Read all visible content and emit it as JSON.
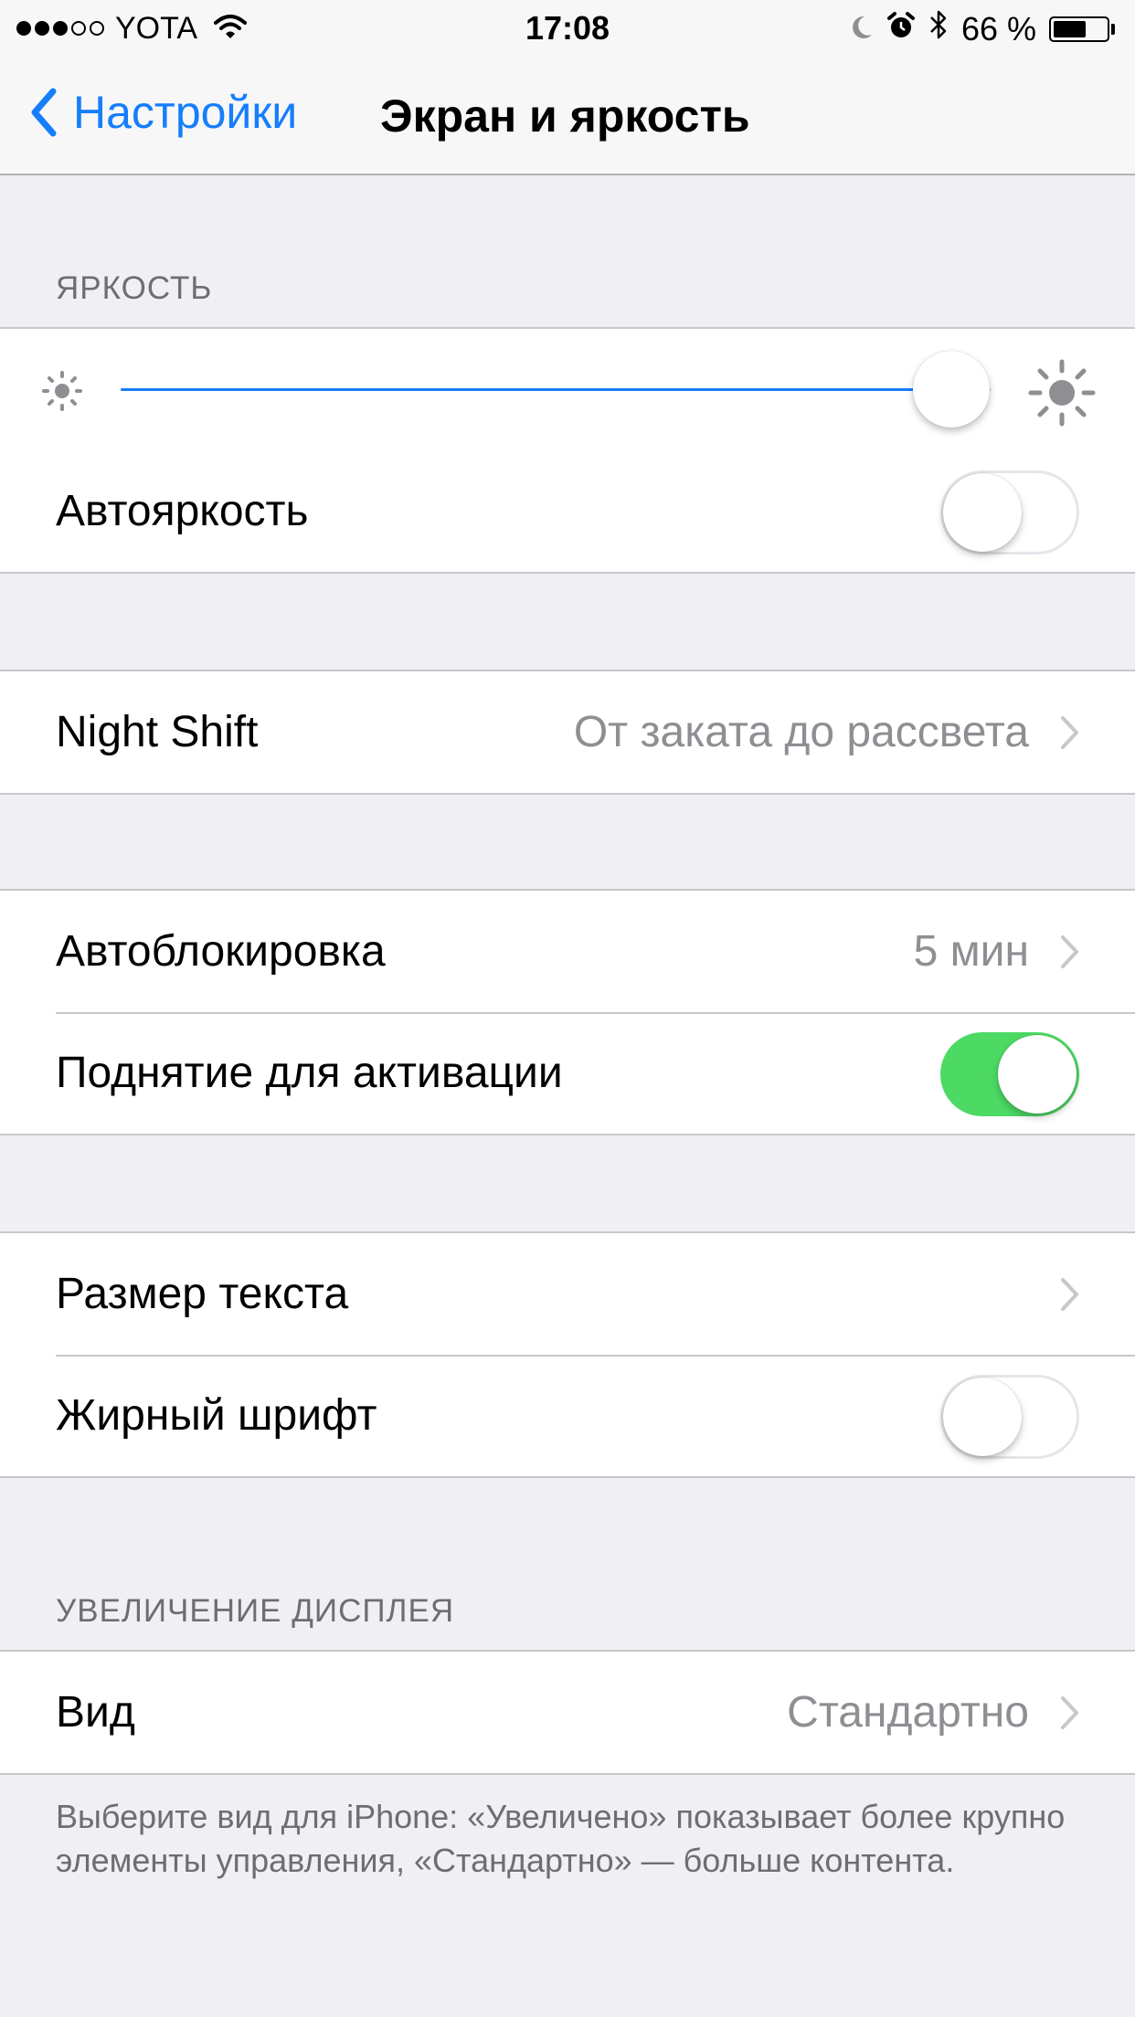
{
  "status_bar": {
    "signal_dots_filled": 3,
    "signal_dots_total": 5,
    "carrier": "YOTA",
    "time": "17:08",
    "battery_percent_label": "66 %",
    "battery_level": 0.66,
    "icons": [
      "wifi-icon",
      "moon-icon",
      "alarm-icon",
      "bluetooth-icon",
      "battery-icon"
    ]
  },
  "nav": {
    "back_label": "Настройки",
    "title": "Экран и яркость"
  },
  "sections": {
    "brightness": {
      "header": "ЯРКОСТЬ",
      "slider_level": 0.955,
      "auto_label": "Автояркость",
      "auto_on": false
    },
    "night_shift": {
      "label": "Night Shift",
      "value": "От заката до рассвета"
    },
    "lock": {
      "autolock_label": "Автоблокировка",
      "autolock_value": "5 мин",
      "raise_label": "Поднятие для активации",
      "raise_on": true
    },
    "text": {
      "size_label": "Размер текста",
      "bold_label": "Жирный шрифт",
      "bold_on": false
    },
    "zoom": {
      "header": "УВЕЛИЧЕНИЕ ДИСПЛЕЯ",
      "view_label": "Вид",
      "view_value": "Стандартно",
      "footer": "Выберите вид для iPhone: «Увеличено» показывает более крупно элементы управления, «Стандартно» — больше контента."
    }
  },
  "colors": {
    "accent": "#157efb",
    "switch_on": "#4cd964",
    "background": "#efeff4",
    "secondary_text": "#8e8e93"
  }
}
